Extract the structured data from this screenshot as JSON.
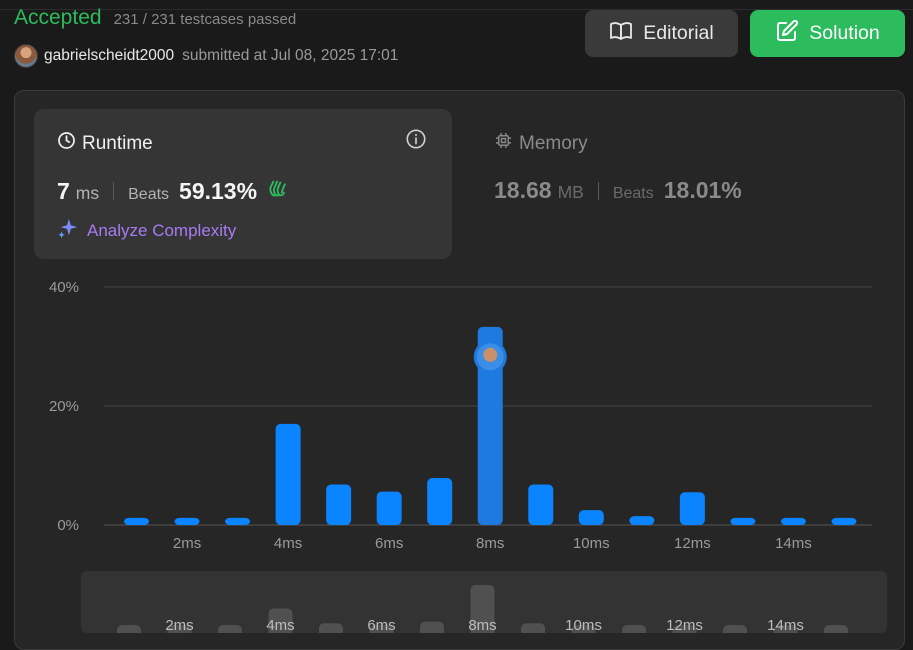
{
  "submission": {
    "status": "Accepted",
    "testcases": "231 / 231 testcases passed",
    "username": "gabrielscheidt2000",
    "submitted_text": "submitted at Jul 08, 2025 17:01"
  },
  "buttons": {
    "editorial": "Editorial",
    "solution": "Solution"
  },
  "runtime": {
    "title": "Runtime",
    "value": "7",
    "unit": "ms",
    "beats_label": "Beats",
    "beats_value": "59.13%",
    "analyze": "Analyze Complexity",
    "icon": "clock-icon"
  },
  "memory": {
    "title": "Memory",
    "value": "18.68",
    "unit": "MB",
    "beats_label": "Beats",
    "beats_value": "18.01%",
    "icon": "chip-icon"
  },
  "colors": {
    "accent_green": "#2cbb5d",
    "bar_blue": "#0a84ff",
    "highlight_blue": "#1f7ae0",
    "analyze_purple": "#a77bf3"
  },
  "chart_data": {
    "type": "bar",
    "categories": [
      "1ms",
      "2ms",
      "3ms",
      "4ms",
      "5ms",
      "6ms",
      "7ms",
      "8ms",
      "9ms",
      "10ms",
      "11ms",
      "12ms",
      "13ms",
      "14ms",
      "15ms"
    ],
    "values": [
      1.2,
      1.2,
      1.2,
      17.0,
      6.8,
      5.6,
      7.9,
      33.3,
      6.8,
      2.5,
      1.5,
      5.5,
      1.2,
      1.2,
      1.2
    ],
    "highlight_index": 7,
    "ylim": [
      0,
      40
    ],
    "yticks": [
      "0%",
      "20%",
      "40%"
    ],
    "xtick_labels": [
      "2ms",
      "4ms",
      "6ms",
      "8ms",
      "10ms",
      "12ms",
      "14ms"
    ],
    "grid": true
  },
  "overview_data": {
    "values": [
      1.2,
      1.2,
      1.2,
      17.0,
      6.8,
      5.6,
      7.9,
      33.3,
      6.8,
      2.5,
      1.5,
      5.5,
      1.2,
      1.2,
      1.2
    ],
    "xtick_labels": [
      "2ms",
      "4ms",
      "6ms",
      "8ms",
      "10ms",
      "12ms",
      "14ms"
    ]
  }
}
